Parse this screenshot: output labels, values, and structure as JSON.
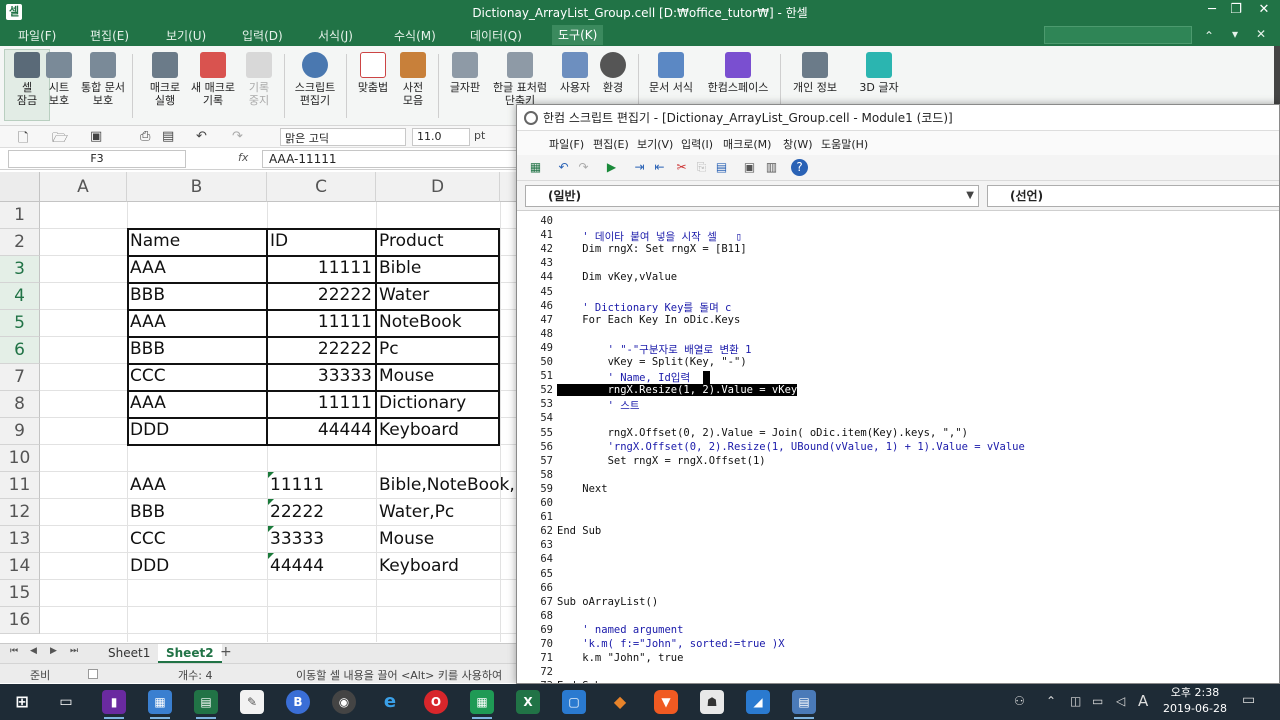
{
  "window": {
    "title": "Dictionay_ArrayList_Group.cell [D:₩office_tutor₩] - 한셀",
    "app_icon_text": "셀"
  },
  "menu": [
    "파일(F)",
    "편집(E)",
    "보기(U)",
    "입력(D)",
    "서식(J)",
    "수식(M)",
    "데이터(Q)",
    "도구(K)"
  ],
  "ribbon": {
    "buttons": [
      {
        "label": "셀\n잠금",
        "icon": "lock-cell-icon"
      },
      {
        "label": "시트\n보호",
        "icon": "protect-sheet-icon"
      },
      {
        "label": "통합 문서\n보호",
        "icon": "protect-workbook-icon"
      },
      {
        "label": "매크로\n실행",
        "icon": "run-macro-icon"
      },
      {
        "label": "새 매크로\n기록",
        "icon": "record-macro-icon"
      },
      {
        "label": "기록\n중지",
        "icon": "stop-record-icon"
      },
      {
        "label": "스크립트\n편집기",
        "icon": "script-editor-icon"
      },
      {
        "label": "맞춤법",
        "icon": "spellcheck-icon"
      },
      {
        "label": "사전\n모음",
        "icon": "dictionary-icon"
      },
      {
        "label": "글자판",
        "icon": "keyboard-icon"
      },
      {
        "label": "한글 표처럼\n단축키",
        "icon": "shortcut-icon"
      },
      {
        "label": "사용자",
        "icon": "user-icon"
      },
      {
        "label": "환경",
        "icon": "gear-icon"
      },
      {
        "label": "문서 서식",
        "icon": "doc-format-icon"
      },
      {
        "label": "한컴스페이스",
        "icon": "hancom-space-icon"
      },
      {
        "label": "개인 정보",
        "icon": "privacy-icon"
      },
      {
        "label": "3D 글자",
        "icon": "3d-text-icon"
      }
    ]
  },
  "toolbar": {
    "font_name": "맑은 고딕",
    "font_size": "11.0",
    "font_unit": "pt"
  },
  "formula": {
    "name_box": "F3",
    "fx": "fx",
    "value": "AAA-11111"
  },
  "sheet": {
    "columns": [
      "A",
      "B",
      "C",
      "D"
    ],
    "rows": [
      "1",
      "2",
      "3",
      "4",
      "5",
      "6",
      "7",
      "8",
      "9",
      "10",
      "11",
      "12",
      "13",
      "14",
      "15",
      "16"
    ],
    "table": [
      [
        "Name",
        "ID",
        "Product"
      ],
      [
        "AAA",
        "11111",
        "Bible"
      ],
      [
        "BBB",
        "22222",
        "Water"
      ],
      [
        "AAA",
        "11111",
        "NoteBook"
      ],
      [
        "BBB",
        "22222",
        "Pc"
      ],
      [
        "CCC",
        "33333",
        "Mouse"
      ],
      [
        "AAA",
        "11111",
        "Dictionary"
      ],
      [
        "DDD",
        "44444",
        "Keyboard"
      ]
    ],
    "result": [
      [
        "AAA",
        "11111",
        "Bible,NoteBook,D"
      ],
      [
        "BBB",
        "22222",
        "Water,Pc"
      ],
      [
        "CCC",
        "33333",
        "Mouse"
      ],
      [
        "DDD",
        "44444",
        "Keyboard"
      ]
    ]
  },
  "tabs": {
    "sheets": [
      "Sheet1",
      "Sheet2"
    ],
    "active": "Sheet2",
    "add": "+"
  },
  "status": {
    "mode": "준비",
    "count": "개수: 4",
    "hint": "이동할 셀 내용을 끌어 <Alt> 키를 사용하여"
  },
  "editor": {
    "title": "한컴 스크립트 편집기 - [Dictionay_ArrayList_Group.cell - Module1 (코드)]",
    "menu": [
      "파일(F)",
      "편집(E)",
      "보기(V)",
      "입력(I)",
      "매크로(M)",
      "창(W)",
      "도움말(H)"
    ],
    "combo_left": "(일반)",
    "combo_right": "(선언)",
    "lines": [
      {
        "n": "40",
        "t": ""
      },
      {
        "n": "41",
        "t": "    ' 데이타 붙여 넣을 시작 셀   ▯"
      },
      {
        "n": "42",
        "t": "    Dim rngX: Set rngX = [B11]"
      },
      {
        "n": "43",
        "t": ""
      },
      {
        "n": "44",
        "t": "    Dim vKey,vValue"
      },
      {
        "n": "45",
        "t": ""
      },
      {
        "n": "46",
        "t": "    ' Dictionary Key를 돌며 c"
      },
      {
        "n": "47",
        "t": "    For Each Key In oDic.Keys"
      },
      {
        "n": "48",
        "t": ""
      },
      {
        "n": "49",
        "t": "        ' \"-\"구분자로 배열로 변환 1"
      },
      {
        "n": "50",
        "t": "        vKey = Split(Key, \"-\")"
      },
      {
        "n": "51",
        "t": "        ' Name, Id입력"
      },
      {
        "n": "52",
        "t": "        rngX.Resize(1, 2).Value = vKey"
      },
      {
        "n": "53",
        "t": "        ' 스트"
      },
      {
        "n": "54",
        "t": ""
      },
      {
        "n": "55",
        "t": "        rngX.Offset(0, 2).Value = Join( oDic.item(Key).keys, \",\")"
      },
      {
        "n": "56",
        "t": "        'rngX.Offset(0, 2).Resize(1, UBound(vValue, 1) + 1).Value = vValue"
      },
      {
        "n": "57",
        "t": "        Set rngX = rngX.Offset(1)"
      },
      {
        "n": "58",
        "t": ""
      },
      {
        "n": "59",
        "t": "    Next"
      },
      {
        "n": "60",
        "t": ""
      },
      {
        "n": "61",
        "t": ""
      },
      {
        "n": "62",
        "t": "End Sub"
      },
      {
        "n": "63",
        "t": ""
      },
      {
        "n": "64",
        "t": ""
      },
      {
        "n": "65",
        "t": ""
      },
      {
        "n": "66",
        "t": ""
      },
      {
        "n": "67",
        "t": "Sub oArrayList()"
      },
      {
        "n": "68",
        "t": ""
      },
      {
        "n": "69",
        "t": "    ' named argument"
      },
      {
        "n": "70",
        "t": "    'k.m( f:=\"John\", sorted:=true )X"
      },
      {
        "n": "71",
        "t": "    k.m \"John\", true"
      },
      {
        "n": "72",
        "t": ""
      },
      {
        "n": "73",
        "t": "End Sub"
      }
    ]
  },
  "taskbar": {
    "time": "오후 2:38",
    "date": "2019-06-28",
    "ime": "A"
  },
  "colors": {
    "brand": "#217346",
    "taskbar": "#1e2b36"
  }
}
